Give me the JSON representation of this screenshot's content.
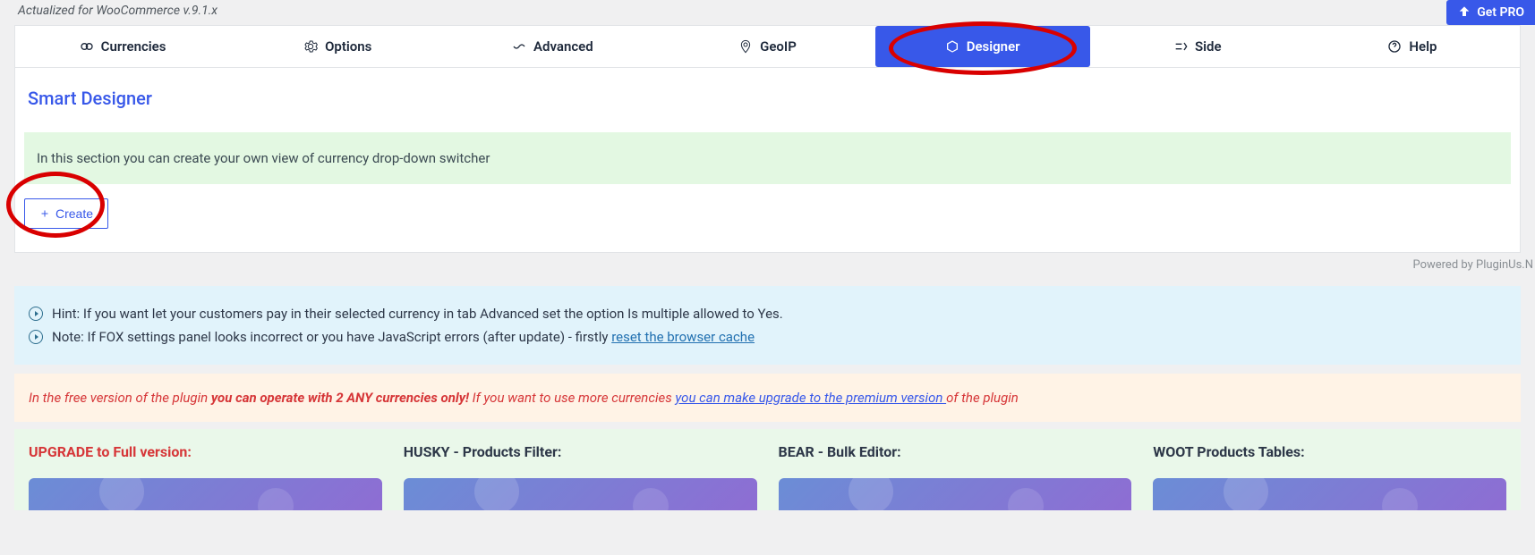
{
  "header": {
    "version_line": "Actualized for WooCommerce v.9.1.x",
    "get_pro": "Get PRO"
  },
  "tabs": {
    "currencies": "Currencies",
    "options": "Options",
    "advanced": "Advanced",
    "geoip": "GeoIP",
    "designer": "Designer",
    "side": "Side",
    "help": "Help"
  },
  "designer": {
    "title": "Smart Designer",
    "info_text": "In this section you can create your own view of currency drop-down switcher",
    "create_label": "Create"
  },
  "powered_by": "Powered by PluginUs.N",
  "hints": {
    "hint_prefix": "Hint: ",
    "hint_text": "If you want let your customers pay in their selected currency in tab Advanced set the option Is multiple allowed to Yes.",
    "note_prefix": "Note: ",
    "note_text": "If FOX settings panel looks incorrect or you have JavaScript errors (after update) - firstly ",
    "note_link": "reset the browser cache"
  },
  "upgrade_notice": {
    "part1": "In the free version of the plugin ",
    "bold": "you can operate with 2 ANY currencies only!",
    "part2": " If you want to use more currencies ",
    "link": "you can make upgrade to the premium version ",
    "part3": "of the plugin"
  },
  "promos": {
    "upgrade": "UPGRADE to Full version:",
    "husky": "HUSKY - Products Filter:",
    "bear": "BEAR - Bulk Editor:",
    "woot": "WOOT Products Tables:"
  }
}
